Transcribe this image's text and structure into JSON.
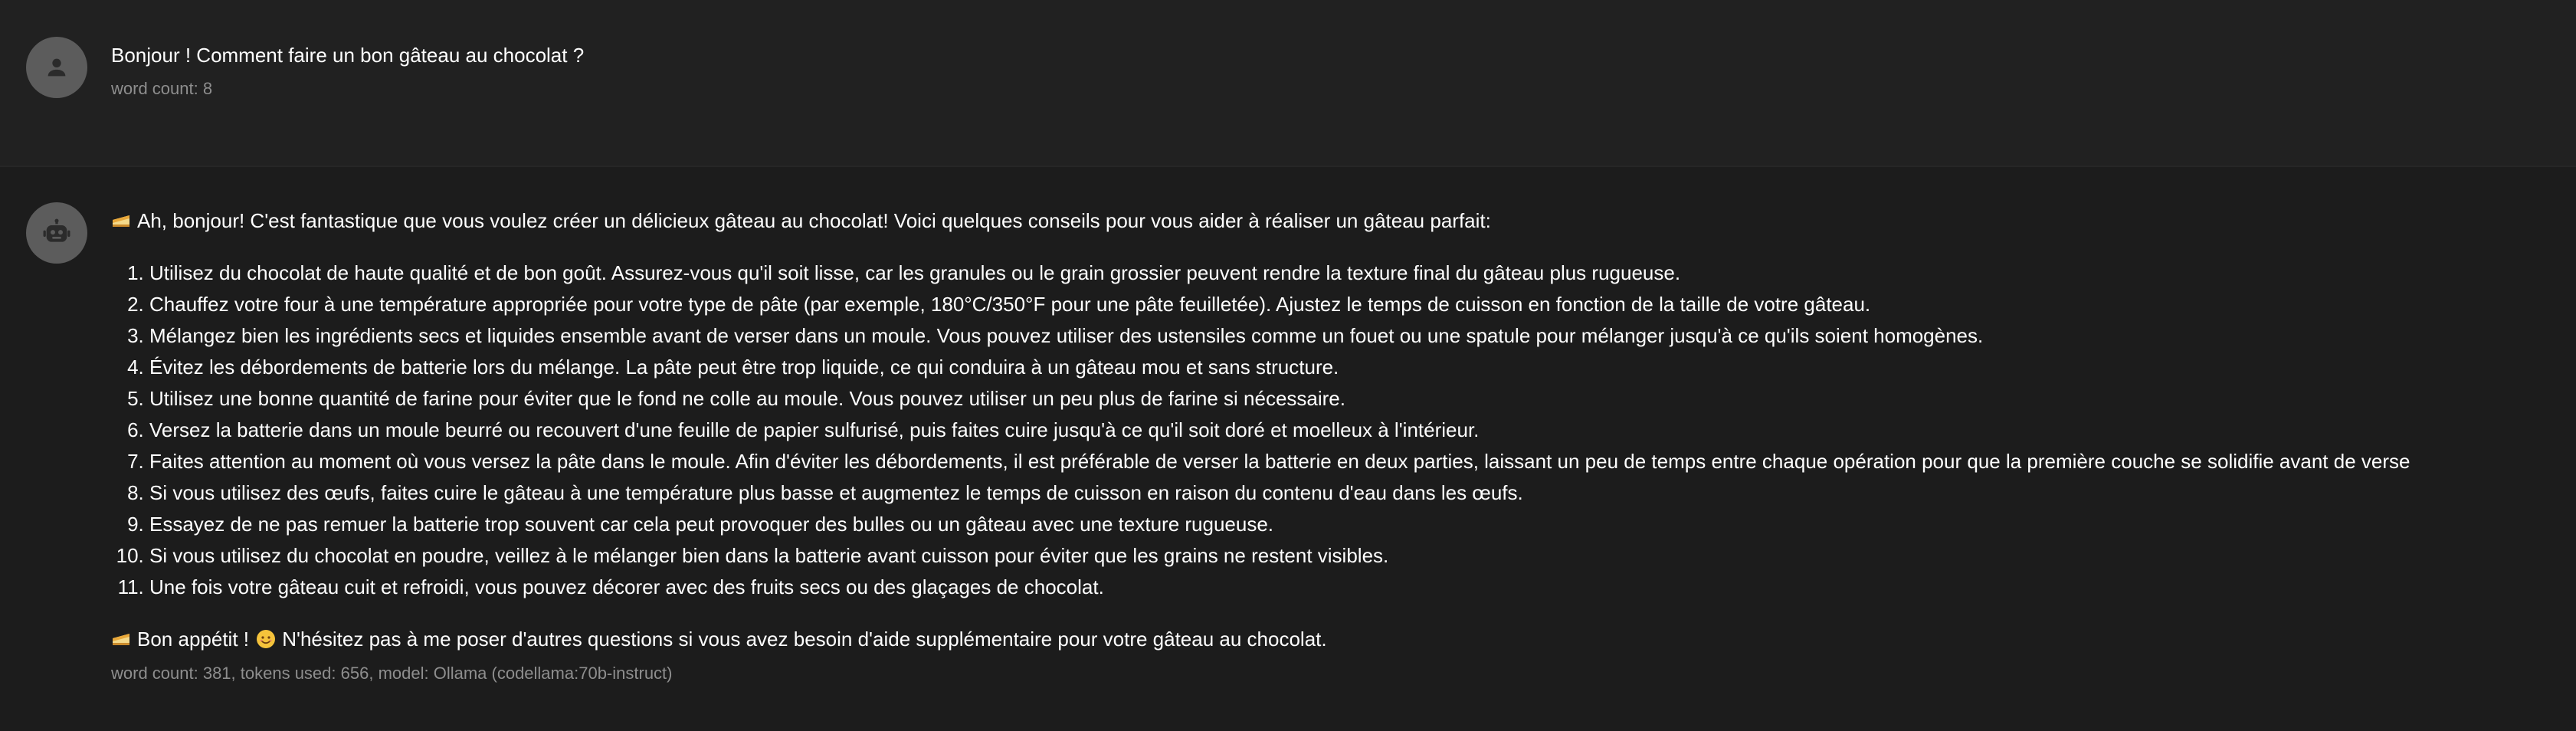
{
  "conversation": {
    "user_message": {
      "avatar_icon": "user-icon",
      "text": "Bonjour ! Comment faire un bon gâteau au chocolat ?",
      "meta": "word count: 8"
    },
    "bot_message": {
      "avatar_icon": "robot-icon",
      "intro_emoji": "cake-icon",
      "intro": "Ah, bonjour! C'est fantastique que vous voulez créer un délicieux gâteau au chocolat! Voici quelques conseils pour vous aider à réaliser un gâteau parfait:",
      "steps": [
        "Utilisez du chocolat de haute qualité et de bon goût. Assurez-vous qu'il soit lisse, car les granules ou le grain grossier peuvent rendre la texture final du gâteau plus rugueuse.",
        "Chauffez votre four à une température appropriée pour votre type de pâte (par exemple, 180°C/350°F pour une pâte feuilletée). Ajustez le temps de cuisson en fonction de la taille de votre gâteau.",
        "Mélangez bien les ingrédients secs et liquides ensemble avant de verser dans un moule. Vous pouvez utiliser des ustensiles comme un fouet ou une spatule pour mélanger jusqu'à ce qu'ils soient homogènes.",
        "Évitez les débordements de batterie lors du mélange. La pâte peut être trop liquide, ce qui conduira à un gâteau mou et sans structure.",
        "Utilisez une bonne quantité de farine pour éviter que le fond ne colle au moule. Vous pouvez utiliser un peu plus de farine si nécessaire.",
        "Versez la batterie dans un moule beurré ou recouvert d'une feuille de papier sulfurisé, puis faites cuire jusqu'à ce qu'il soit doré et moelleux à l'intérieur.",
        "Faites attention au moment où vous versez la pâte dans le moule. Afin d'éviter les débordements, il est préférable de verser la batterie en deux parties, laissant un peu de temps entre chaque opération pour que la première couche se solidifie avant de verse",
        "Si vous utilisez des œufs, faites cuire le gâteau à une température plus basse et augmentez le temps de cuisson en raison du contenu d'eau dans les œufs.",
        "Essayez de ne pas remuer la batterie trop souvent car cela peut provoquer des bulles ou un gâteau avec une texture rugueuse.",
        "Si vous utilisez du chocolat en poudre, veillez à le mélanger bien dans la batterie avant cuisson pour éviter que les grains ne restent visibles.",
        "Une fois votre gâteau cuit et refroidi, vous pouvez décorer avec des fruits secs ou des glaçages de chocolat."
      ],
      "outro_emoji": "cake-icon",
      "outro_part1": "Bon appétit !",
      "outro_smile": "smiling-face-icon",
      "outro_part2": "N'hésitez pas à me poser d'autres questions si vous avez besoin d'aide supplémentaire pour votre gâteau au chocolat.",
      "meta": "word count: 381, tokens used: 656, model: Ollama (codellama:70b-instruct)"
    }
  },
  "colors": {
    "background": "#212121",
    "bot_background": "#1c1c1c",
    "avatar": "#5c5c5c",
    "meta_text": "#8e8e8e"
  }
}
